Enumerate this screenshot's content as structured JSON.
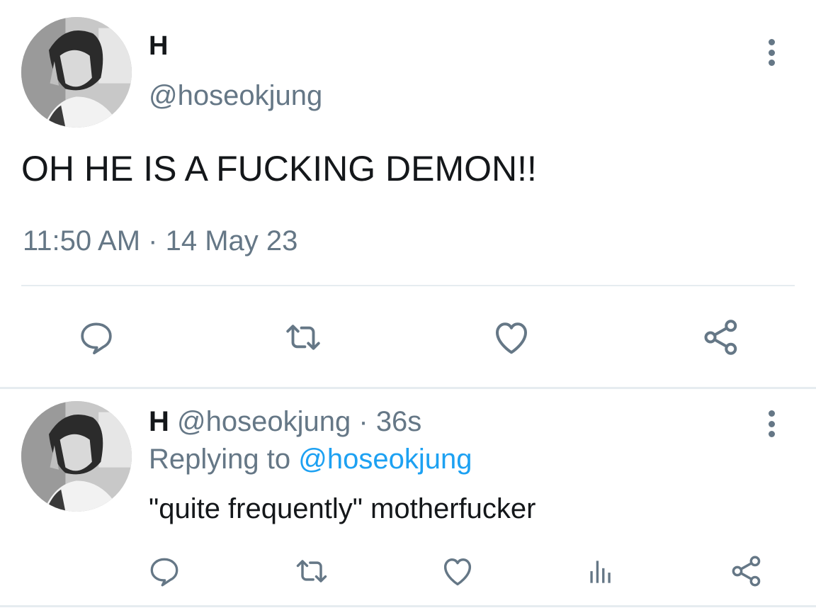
{
  "main_tweet": {
    "name": "H",
    "handle": "@hoseokjung",
    "text": "OH HE IS A FUCKING DEMON!!",
    "meta": "11:50 AM · 14 May 23",
    "avatar": "profile-photo-grayscale",
    "actions": [
      "reply-icon",
      "retweet-icon",
      "like-icon",
      "share-icon"
    ]
  },
  "reply_tweet": {
    "name": "H",
    "handle": "@hoseokjung",
    "separator": "·",
    "time": "36s",
    "replying_prefix": "Replying to",
    "replying_to": "@hoseokjung",
    "text": "\"quite frequently\" motherfucker",
    "avatar": "profile-photo-grayscale",
    "actions": [
      "reply-icon",
      "retweet-icon",
      "like-icon",
      "analytics-icon",
      "share-icon"
    ]
  },
  "colors": {
    "primary_text": "#14171a",
    "secondary_text": "#657786",
    "link": "#1da1f2",
    "divider": "#e6ecf0"
  }
}
